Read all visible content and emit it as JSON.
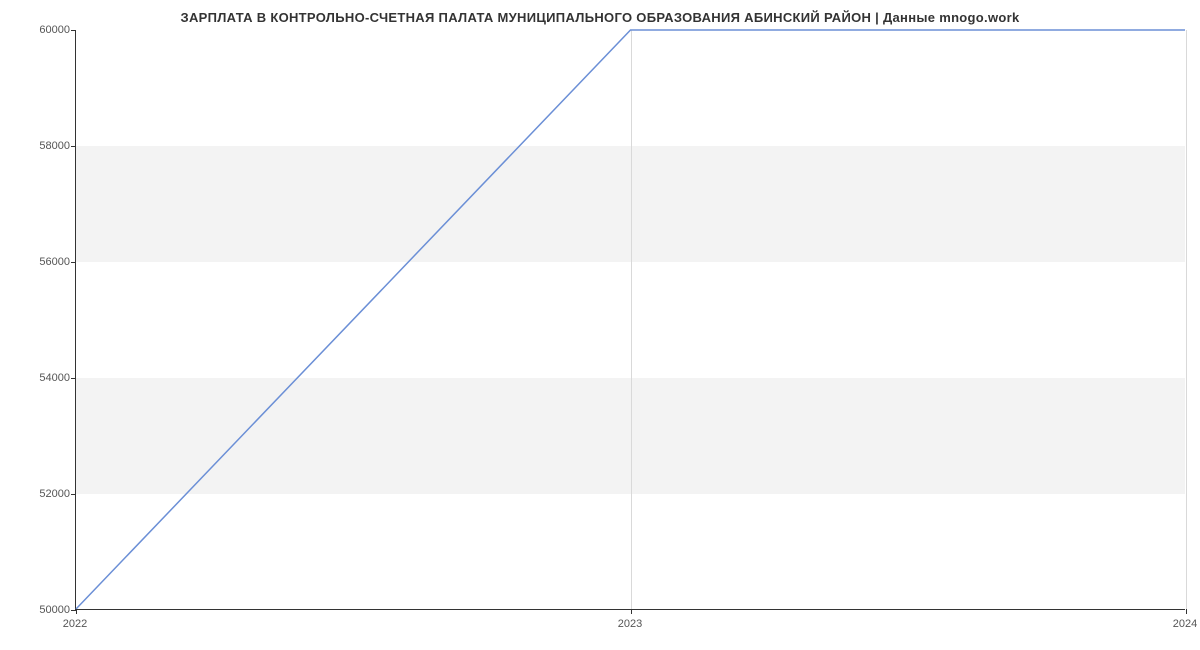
{
  "chart_data": {
    "type": "line",
    "title": "ЗАРПЛАТА В КОНТРОЛЬНО-СЧЕТНАЯ ПАЛАТА МУНИЦИПАЛЬНОГО ОБРАЗОВАНИЯ АБИНСКИЙ РАЙОН | Данные mnogo.work",
    "x": [
      2022,
      2023,
      2024
    ],
    "values": [
      50000,
      60000,
      60000
    ],
    "xlabel": "",
    "ylabel": "",
    "xlim": [
      2022,
      2024
    ],
    "ylim": [
      50000,
      60000
    ],
    "x_ticks": [
      2022,
      2023,
      2024
    ],
    "y_ticks": [
      50000,
      52000,
      54000,
      56000,
      58000,
      60000
    ]
  }
}
